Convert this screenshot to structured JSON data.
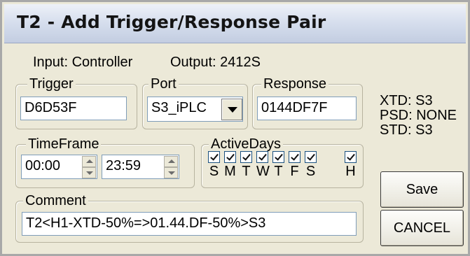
{
  "window": {
    "title": "T2 - Add Trigger/Response Pair"
  },
  "header": {
    "input_label": "Input: Controller",
    "output_label": "Output: 2412S"
  },
  "trigger": {
    "label": "Trigger",
    "value": "D6D53F"
  },
  "port": {
    "label": "Port",
    "value": "S3_iPLC"
  },
  "response": {
    "label": "Response",
    "value": "0144DF7F"
  },
  "status": {
    "xtd": "XTD: S3",
    "psd": "PSD: NONE",
    "std": "STD: S3"
  },
  "timeframe": {
    "label": "TimeFrame",
    "start": "00:00",
    "end": "23:59"
  },
  "active_days": {
    "label": "ActiveDays",
    "days": [
      {
        "label": "S",
        "checked": true
      },
      {
        "label": "M",
        "checked": true
      },
      {
        "label": "T",
        "checked": true
      },
      {
        "label": "W",
        "checked": true
      },
      {
        "label": "T",
        "checked": true
      },
      {
        "label": "F",
        "checked": true
      },
      {
        "label": "S",
        "checked": true
      },
      {
        "label": "H",
        "checked": true
      }
    ]
  },
  "comment": {
    "label": "Comment",
    "value": "T2<H1-XTD-50%=>01.44.DF-50%>S3"
  },
  "buttons": {
    "save": "Save",
    "cancel": "CANCEL"
  }
}
